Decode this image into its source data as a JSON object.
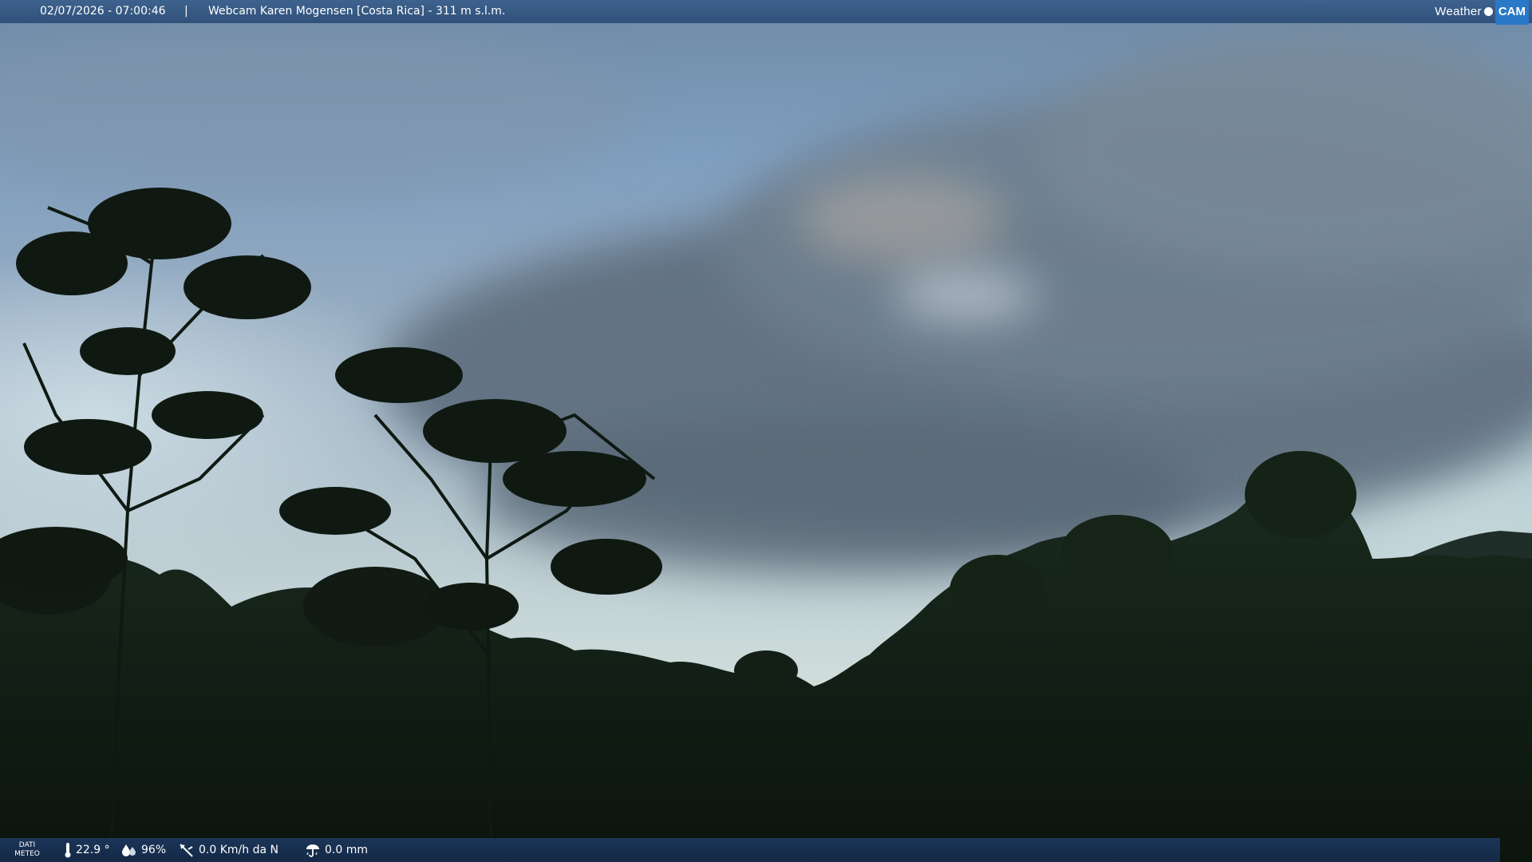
{
  "overlay": {
    "datetime": "02/07/2026 - 07:00:46",
    "separator": "|",
    "title": "Webcam Karen Mogensen [Costa Rica]  - 311 m s.l.m.",
    "brand_weather": "Weather",
    "brand_cam": "CAM"
  },
  "weather": {
    "label_line1": "DATI",
    "label_line2": "METEO",
    "temperature": "22.9 °",
    "humidity": "96%",
    "wind": "0.0 Km/h da N",
    "rain": "0.0 mm"
  },
  "icons": {
    "temperature": "thermometer-icon",
    "humidity": "humidity-drops-icon",
    "wind": "wind-vane-icon",
    "rain": "rain-gauge-icon"
  },
  "colors": {
    "bar_top": "#3a5f8c",
    "bar_bottom": "#1c365c",
    "brand_cam_bg": "#2a79c8"
  }
}
